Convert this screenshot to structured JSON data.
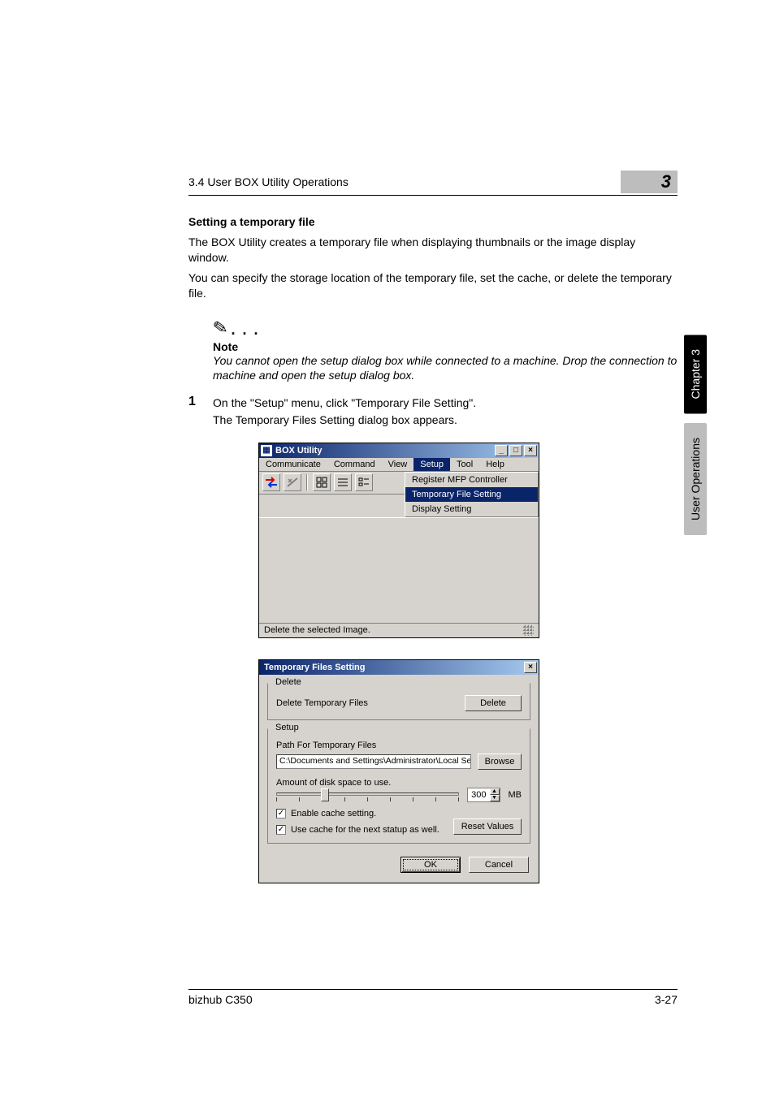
{
  "header": {
    "breadcrumb": "3.4 User BOX Utility Operations",
    "chapter_index": "3"
  },
  "side_tabs": {
    "chapter": "Chapter 3",
    "section": "User Operations"
  },
  "section": {
    "title": "Setting a temporary file",
    "p1": "The BOX Utility creates a temporary file when displaying thumbnails or the image display window.",
    "p2": "You can specify the storage location of the temporary file, set the cache, or delete the temporary file."
  },
  "note": {
    "label": "Note",
    "text": "You cannot open the setup dialog box while connected to a machine. Drop the connection to machine and open the setup dialog box."
  },
  "step1": {
    "num": "1",
    "line1": "On the \"Setup\" menu, click \"Temporary File Setting\".",
    "line2": "The Temporary Files Setting dialog box appears."
  },
  "box_utility": {
    "title": "BOX Utility",
    "menu": {
      "communicate": "Communicate",
      "command": "Command",
      "view": "View",
      "setup": "Setup",
      "tool": "Tool",
      "help": "Help"
    },
    "setup_menu": {
      "register": "Register MFP Controller",
      "temp": "Temporary File Setting",
      "display": "Display Setting"
    },
    "toolbar_icons": {
      "connect": "connect-icon",
      "disconnect": "disconnect-icon",
      "thumb": "thumbnail-view-icon",
      "list": "list-view-icon",
      "detail": "detail-view-icon"
    },
    "status": "Delete the selected Image."
  },
  "dlg": {
    "title": "Temporary Files Setting",
    "delete_group": {
      "legend": "Delete",
      "label": "Delete Temporary Files",
      "button": "Delete"
    },
    "setup_group": {
      "legend": "Setup",
      "path_label": "Path For Temporary Files",
      "path_value": "C:\\Documents and Settings\\Administrator\\Local Settings\\Temp\\",
      "browse": "Browse",
      "disk_label": "Amount of disk space to use.",
      "spin_value": "300",
      "spin_unit": "MB",
      "chk_enable": "Enable cache setting.",
      "chk_persist": "Use cache for the next statup as well.",
      "reset": "Reset Values"
    },
    "ok": "OK",
    "cancel": "Cancel"
  },
  "footer": {
    "product": "bizhub C350",
    "page": "3-27"
  }
}
